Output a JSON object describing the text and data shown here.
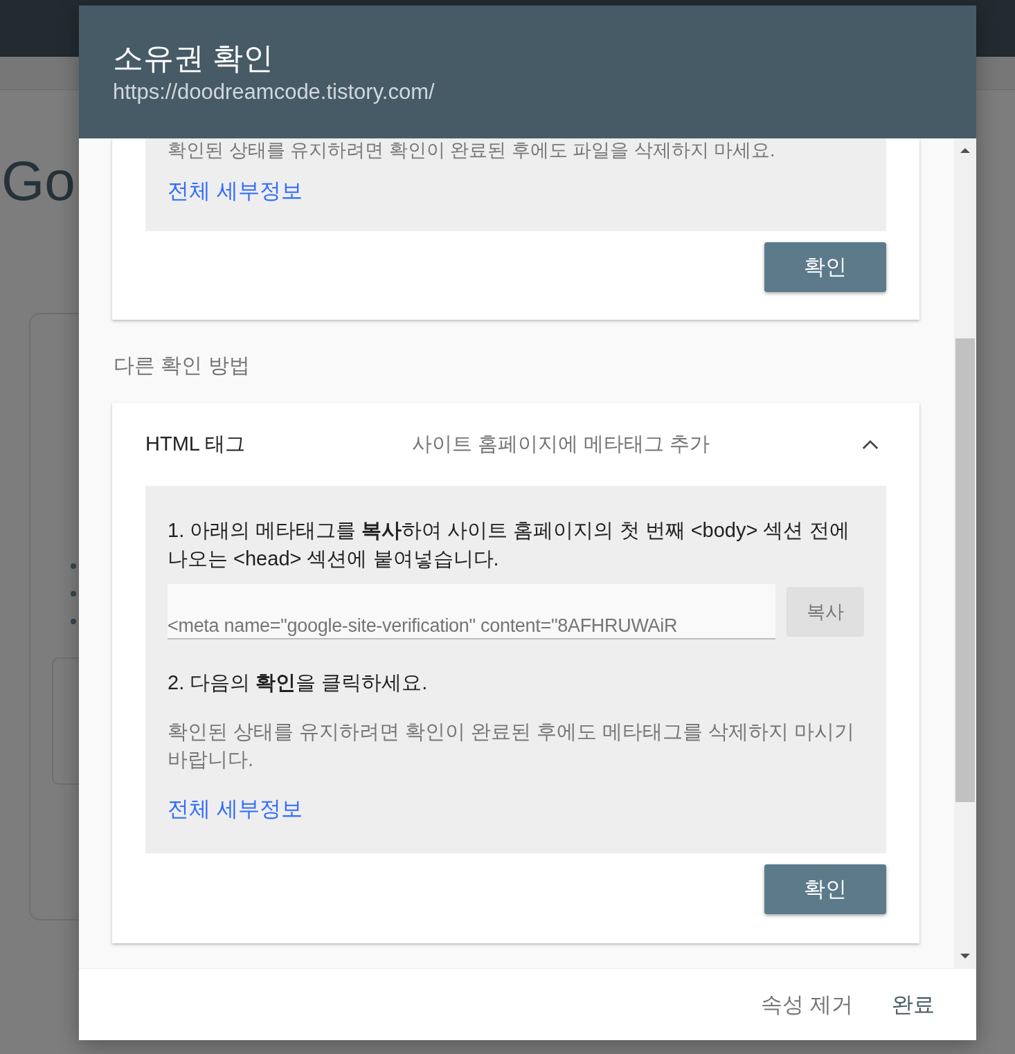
{
  "window": {
    "title": "소유권 확인",
    "subtitle": "https://doodreamcode.tistory.com/"
  },
  "background": {
    "logo_text": "Go"
  },
  "first_method": {
    "note": "확인된 상태를 유지하려면 확인이 완료된 후에도 파일을 삭제하지 마세요.",
    "details_link": "전체 세부정보",
    "verify_button": "확인"
  },
  "other_methods": {
    "heading": "다른 확인 방법",
    "items": [
      {
        "name": "HTML 태그",
        "description": "사이트 홈페이지에 메타태그 추가",
        "expanded": true,
        "steps": [
          "1. 아래의 메타태그를 **복사**하여 사이트 홈페이지의 첫 번째 <body> 섹션 전에 나오는 <head> 섹션에 붙여넣습니다.",
          "2. 다음의 **확인**을 클릭하세요."
        ],
        "code": "<meta name=\"google-site-verification\" content=\"8AFHRUWAiR",
        "copy_button": "복사",
        "note": "확인된 상태를 유지하려면 확인이 완료된 후에도 메타태그를 삭제하지 마시기 바랍니다.",
        "details_link": "전체 세부정보",
        "verify_button": "확인"
      }
    ]
  },
  "footer": {
    "buttons": [
      {
        "label": "속성 제거",
        "kind": "secondary"
      },
      {
        "label": "완료",
        "kind": "primary"
      }
    ]
  }
}
